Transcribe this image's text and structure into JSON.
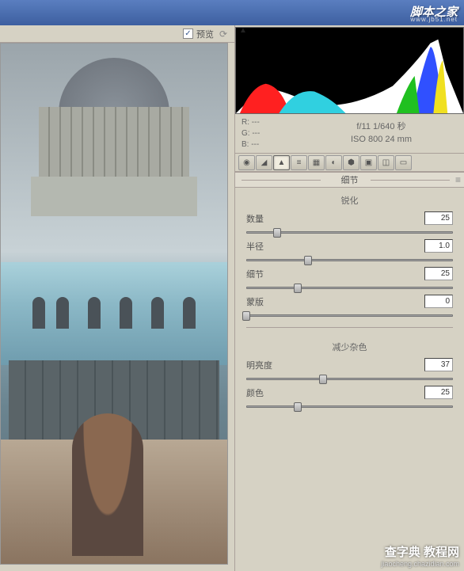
{
  "watermark": {
    "top_main": "脚本之家",
    "top_sub": "www.jb51.net",
    "bottom_main": "查字典 教程网",
    "bottom_sub": "jiaocheng.chazidian.com"
  },
  "preview": {
    "checkbox_checked": "✓",
    "label": "预览"
  },
  "rgb": {
    "r": "R: ---",
    "g": "G: ---",
    "b": "B: ---"
  },
  "exif": {
    "line1": "f/11  1/640 秒",
    "line2": "ISO 800  24 mm"
  },
  "tool_icons": [
    "◉",
    "◢",
    "▲",
    "≡",
    "▦",
    "◐",
    "⬢",
    "▣",
    "◫",
    "▭"
  ],
  "panel": {
    "tab_label": "细节",
    "menu": "≡"
  },
  "sections": {
    "sharpen": "锐化",
    "noise": "减少杂色"
  },
  "sharpen": {
    "amount": {
      "label": "数量",
      "value": "25",
      "pos": 15
    },
    "radius": {
      "label": "半径",
      "value": "1.0",
      "pos": 30
    },
    "detail": {
      "label": "细节",
      "value": "25",
      "pos": 25
    },
    "masking": {
      "label": "蒙版",
      "value": "0",
      "pos": 0
    }
  },
  "noise": {
    "luminance": {
      "label": "明亮度",
      "value": "37",
      "pos": 37
    },
    "color": {
      "label": "颜色",
      "value": "25",
      "pos": 25
    }
  }
}
